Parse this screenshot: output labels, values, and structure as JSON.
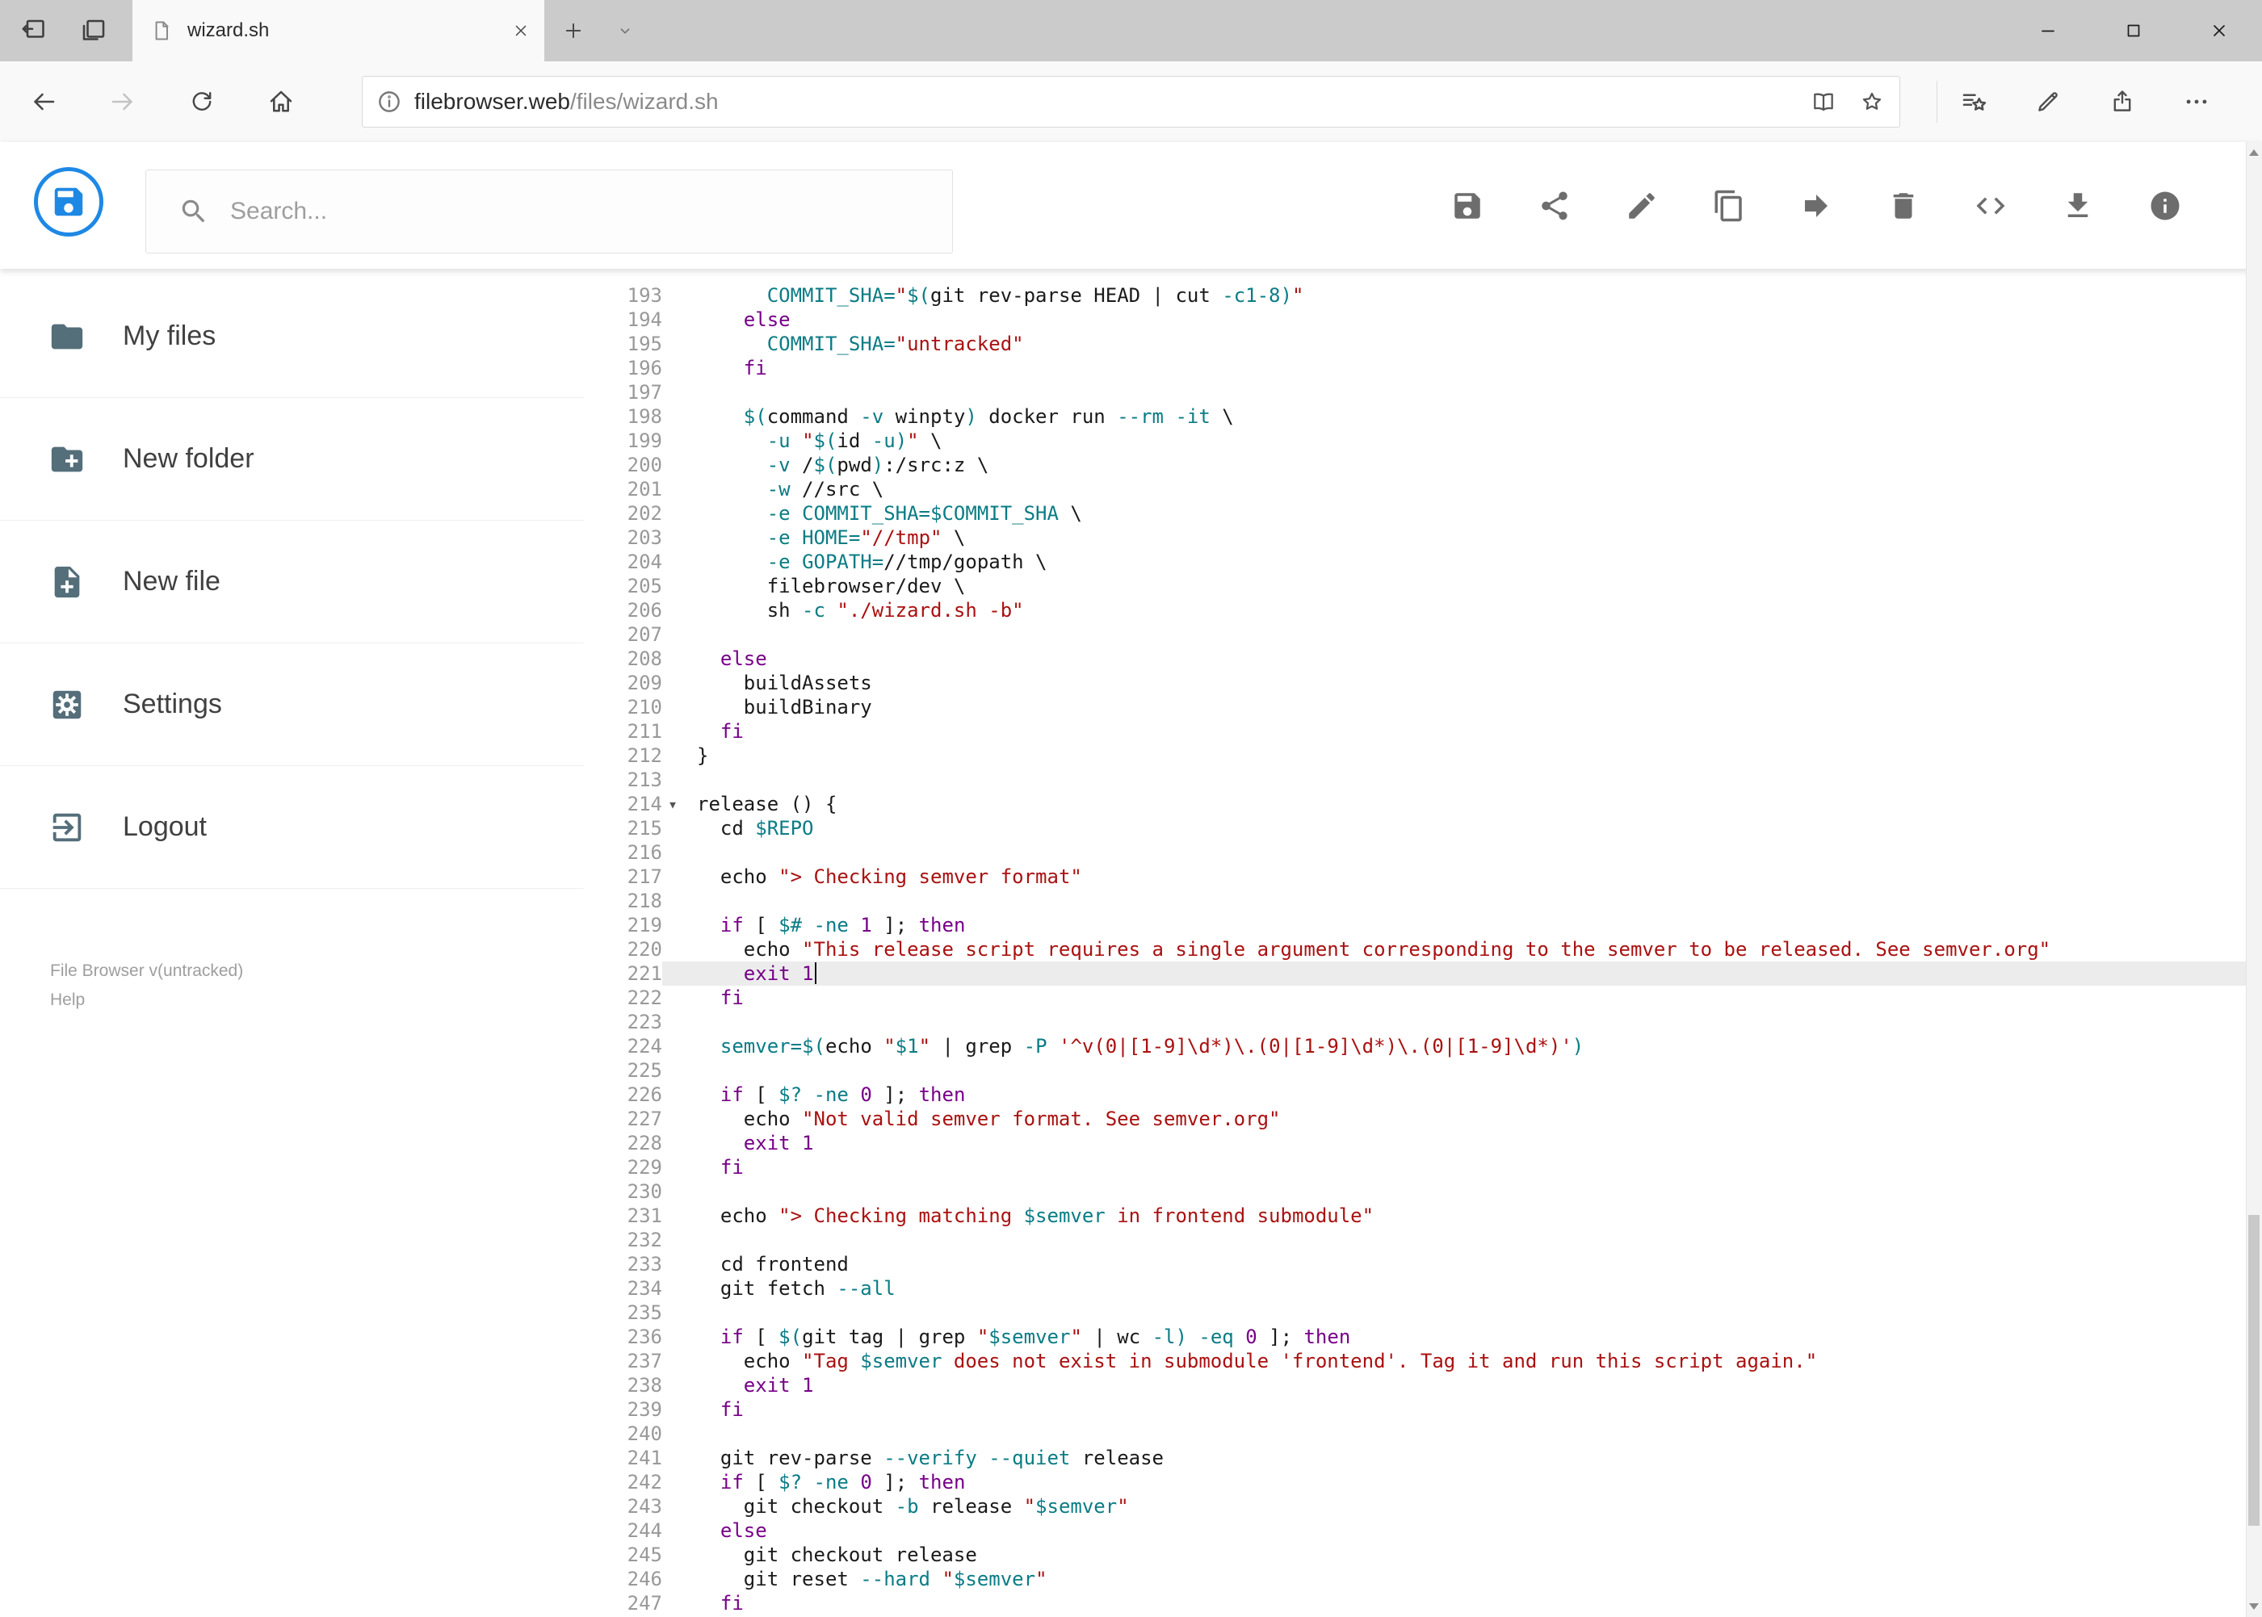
{
  "window": {
    "tab_title": "wizard.sh"
  },
  "browser": {
    "url_domain": "filebrowser.web",
    "url_path": "/files/wizard.sh"
  },
  "app": {
    "search_placeholder": "Search...",
    "toolbar_icons": [
      "save",
      "share",
      "rename",
      "copy",
      "move",
      "delete",
      "raw-code",
      "download",
      "info"
    ],
    "sidebar": [
      {
        "label": "My files",
        "icon": "folder"
      },
      {
        "label": "New folder",
        "icon": "create-new-folder"
      },
      {
        "label": "New file",
        "icon": "note-add"
      },
      {
        "label": "Settings",
        "icon": "settings"
      },
      {
        "label": "Logout",
        "icon": "exit-to-app"
      }
    ],
    "footer_version": "File Browser v(untracked)",
    "footer_help": "Help"
  },
  "colors": {
    "accent": "#1e88e5",
    "sidebar_icon": "#546e7a",
    "toolbar_icon": "#6d6d6d",
    "tabstrip": "#cbcbcb"
  },
  "editor": {
    "active_line": 221,
    "fold_marker_line": 214,
    "palette": {
      "keyword": "#770088",
      "string": "#aa1111",
      "variable": "#0b7c85",
      "definition": "#0b7c85",
      "flag": "#0b7c85",
      "number": "#770088",
      "line_number": "#999999",
      "active_line_bg": "#ececec"
    },
    "lines": [
      {
        "n": 193,
        "t": "      COMMIT_SHA=\"$(git rev-parse HEAD | cut -c1-8)\""
      },
      {
        "n": 194,
        "t": "    else"
      },
      {
        "n": 195,
        "t": "      COMMIT_SHA=\"untracked\""
      },
      {
        "n": 196,
        "t": "    fi"
      },
      {
        "n": 197,
        "t": ""
      },
      {
        "n": 198,
        "t": "    $(command -v winpty) docker run --rm -it \\"
      },
      {
        "n": 199,
        "t": "      -u \"$(id -u)\" \\"
      },
      {
        "n": 200,
        "t": "      -v /$(pwd):/src:z \\"
      },
      {
        "n": 201,
        "t": "      -w //src \\"
      },
      {
        "n": 202,
        "t": "      -e COMMIT_SHA=$COMMIT_SHA \\"
      },
      {
        "n": 203,
        "t": "      -e HOME=\"//tmp\" \\"
      },
      {
        "n": 204,
        "t": "      -e GOPATH=//tmp/gopath \\"
      },
      {
        "n": 205,
        "t": "      filebrowser/dev \\"
      },
      {
        "n": 206,
        "t": "      sh -c \"./wizard.sh -b\""
      },
      {
        "n": 207,
        "t": ""
      },
      {
        "n": 208,
        "t": "  else"
      },
      {
        "n": 209,
        "t": "    buildAssets"
      },
      {
        "n": 210,
        "t": "    buildBinary"
      },
      {
        "n": 211,
        "t": "  fi"
      },
      {
        "n": 212,
        "t": "}"
      },
      {
        "n": 213,
        "t": ""
      },
      {
        "n": 214,
        "t": "release () {"
      },
      {
        "n": 215,
        "t": "  cd $REPO"
      },
      {
        "n": 216,
        "t": ""
      },
      {
        "n": 217,
        "t": "  echo \"> Checking semver format\""
      },
      {
        "n": 218,
        "t": ""
      },
      {
        "n": 219,
        "t": "  if [ $# -ne 1 ]; then"
      },
      {
        "n": 220,
        "t": "    echo \"This release script requires a single argument corresponding to the semver to be released. See semver.org\""
      },
      {
        "n": 221,
        "t": "    exit 1"
      },
      {
        "n": 222,
        "t": "  fi"
      },
      {
        "n": 223,
        "t": ""
      },
      {
        "n": 224,
        "t": "  semver=$(echo \"$1\" | grep -P '^v(0|[1-9]\\d*)\\.(0|[1-9]\\d*)\\.(0|[1-9]\\d*)')"
      },
      {
        "n": 225,
        "t": ""
      },
      {
        "n": 226,
        "t": "  if [ $? -ne 0 ]; then"
      },
      {
        "n": 227,
        "t": "    echo \"Not valid semver format. See semver.org\""
      },
      {
        "n": 228,
        "t": "    exit 1"
      },
      {
        "n": 229,
        "t": "  fi"
      },
      {
        "n": 230,
        "t": ""
      },
      {
        "n": 231,
        "t": "  echo \"> Checking matching $semver in frontend submodule\""
      },
      {
        "n": 232,
        "t": ""
      },
      {
        "n": 233,
        "t": "  cd frontend"
      },
      {
        "n": 234,
        "t": "  git fetch --all"
      },
      {
        "n": 235,
        "t": ""
      },
      {
        "n": 236,
        "t": "  if [ $(git tag | grep \"$semver\" | wc -l) -eq 0 ]; then"
      },
      {
        "n": 237,
        "t": "    echo \"Tag $semver does not exist in submodule 'frontend'. Tag it and run this script again.\""
      },
      {
        "n": 238,
        "t": "    exit 1"
      },
      {
        "n": 239,
        "t": "  fi"
      },
      {
        "n": 240,
        "t": ""
      },
      {
        "n": 241,
        "t": "  git rev-parse --verify --quiet release"
      },
      {
        "n": 242,
        "t": "  if [ $? -ne 0 ]; then"
      },
      {
        "n": 243,
        "t": "    git checkout -b release \"$semver\""
      },
      {
        "n": 244,
        "t": "  else"
      },
      {
        "n": 245,
        "t": "    git checkout release"
      },
      {
        "n": 246,
        "t": "    git reset --hard \"$semver\""
      },
      {
        "n": 247,
        "t": "  fi"
      }
    ]
  }
}
